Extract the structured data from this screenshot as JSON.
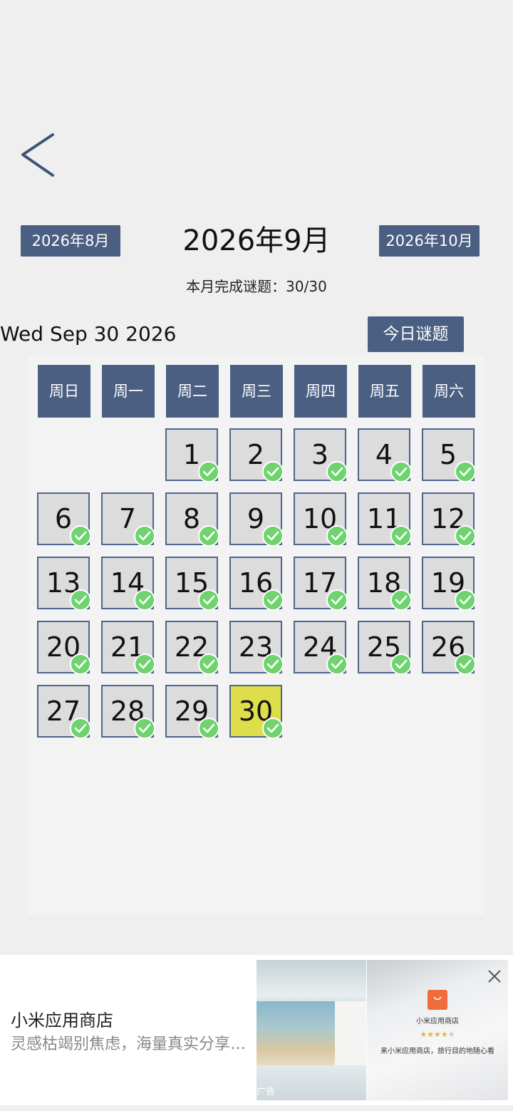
{
  "header": {
    "prev_month": "2026年8月",
    "title": "2026年9月",
    "next_month": "2026年10月",
    "progress_label": "本月完成谜题：",
    "progress_value": "30/30"
  },
  "selected_date": "Wed Sep 30 2026",
  "today_button": "今日谜题",
  "weekdays": [
    "周日",
    "周一",
    "周二",
    "周三",
    "周四",
    "周五",
    "周六"
  ],
  "calendar": {
    "first_weekday_index": 2,
    "days": [
      {
        "num": "1",
        "done": true
      },
      {
        "num": "2",
        "done": true
      },
      {
        "num": "3",
        "done": true
      },
      {
        "num": "4",
        "done": true
      },
      {
        "num": "5",
        "done": true
      },
      {
        "num": "6",
        "done": true
      },
      {
        "num": "7",
        "done": true
      },
      {
        "num": "8",
        "done": true
      },
      {
        "num": "9",
        "done": true
      },
      {
        "num": "10",
        "done": true
      },
      {
        "num": "11",
        "done": true
      },
      {
        "num": "12",
        "done": true
      },
      {
        "num": "13",
        "done": true
      },
      {
        "num": "14",
        "done": true
      },
      {
        "num": "15",
        "done": true
      },
      {
        "num": "16",
        "done": true
      },
      {
        "num": "17",
        "done": true
      },
      {
        "num": "18",
        "done": true
      },
      {
        "num": "19",
        "done": true
      },
      {
        "num": "20",
        "done": true
      },
      {
        "num": "21",
        "done": true
      },
      {
        "num": "22",
        "done": true
      },
      {
        "num": "23",
        "done": true
      },
      {
        "num": "24",
        "done": true
      },
      {
        "num": "25",
        "done": true
      },
      {
        "num": "26",
        "done": true
      },
      {
        "num": "27",
        "done": true
      },
      {
        "num": "28",
        "done": true
      },
      {
        "num": "29",
        "done": true
      },
      {
        "num": "30",
        "done": true,
        "today": true
      }
    ]
  },
  "colors": {
    "accent": "#4b5f82",
    "day_cell": "#dcdcdc",
    "today_cell": "#dede4a",
    "check": "#6fd36f"
  },
  "ad": {
    "title": "小米应用商店",
    "description": "灵感枯竭别焦虑，海量真实分享…",
    "label": "广告",
    "app_name": "小米应用商店",
    "stars_filled": "★★★★",
    "stars_empty": "★",
    "rating": 4,
    "slogan": "来小米应用商店，旅行目的地随心看"
  },
  "icons": {
    "back": "chevron-left-icon",
    "check": "check-circle-icon",
    "close": "close-icon",
    "store": "shopping-bag-icon"
  }
}
